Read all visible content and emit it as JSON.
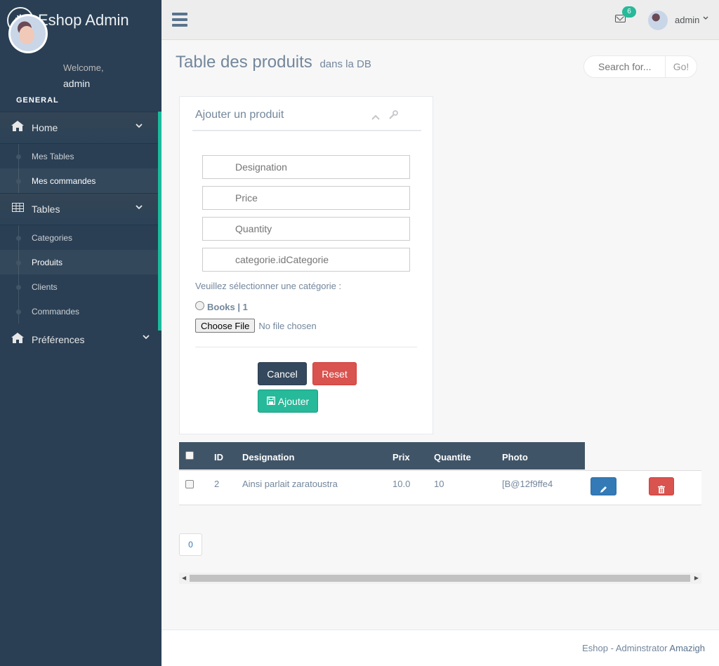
{
  "brand": {
    "title": "Eshop Admin",
    "icon": "gears-icon"
  },
  "profile": {
    "welcome": "Welcome,",
    "name": "admin"
  },
  "section_title": "GENERAL",
  "menu": {
    "home": {
      "label": "Home",
      "icon": "home-icon"
    },
    "home_items": [
      "Mes Tables",
      "Mes commandes"
    ],
    "tables": {
      "label": "Tables",
      "icon": "table-icon"
    },
    "tables_items": [
      "Categories",
      "Produits",
      "Clients",
      "Commandes"
    ],
    "prefs": {
      "label": "Préférences",
      "icon": "home-icon"
    }
  },
  "topnav": {
    "mail_count": "6",
    "user": "admin"
  },
  "page": {
    "title": "Table des produits",
    "subtitle": "dans la DB"
  },
  "search": {
    "placeholder": "Search for...",
    "button": "Go!"
  },
  "form": {
    "title": "Ajouter un produit",
    "fields": {
      "designation": "Designation",
      "price": "Price",
      "quantity": "Quantity",
      "categorie": "categorie.idCategorie"
    },
    "category_prompt": "Veuillez sélectionner une catégorie :",
    "category_option": "Books | 1",
    "file_button": "Choose File",
    "file_status": "No file chosen",
    "cancel": "Cancel",
    "reset": "Reset",
    "submit": "Ajouter"
  },
  "table": {
    "headers": {
      "id": "ID",
      "designation": "Designation",
      "prix": "Prix",
      "quantite": "Quantite",
      "photo": "Photo"
    },
    "rows": [
      {
        "id": "2",
        "designation": "Ainsi parlait zaratoustra",
        "prix": "10.0",
        "quantite": "10",
        "photo": "[B@12f9ffe4"
      }
    ]
  },
  "pagination": {
    "page": "0"
  },
  "footer": {
    "prefix": "Eshop - Adminstrator",
    "author": "Amazigh"
  },
  "colors": {
    "sidebar": "#2A3F54",
    "accent": "#1ABB9C",
    "danger": "#D9534F",
    "primary": "#337AB7",
    "dark": "#34495E"
  }
}
